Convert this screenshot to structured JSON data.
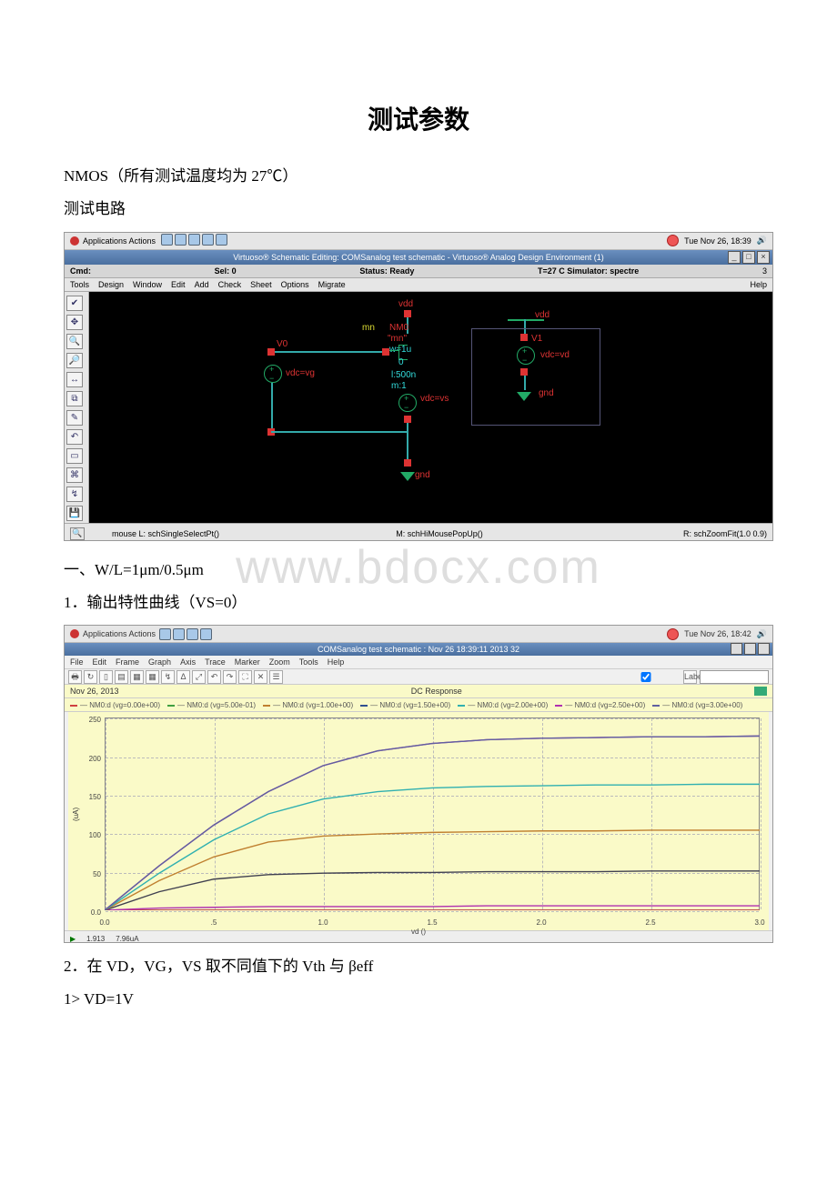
{
  "doc": {
    "title": "测试参数",
    "line1": "NMOS（所有测试温度均为 27℃）",
    "line2": "测试电路",
    "section1": "一、W/L=1μm/0.5μm",
    "item1": "1．输出特性曲线（VS=0）",
    "item2": "2．在 VD，VG，VS 取不同值下的 Vth 与 βeff",
    "sub1": "1> VD=1V",
    "watermark": "www.bdocx.com"
  },
  "shot1": {
    "apps": "Applications  Actions",
    "clock": "Tue Nov 26, 18:39",
    "title": "Virtuoso® Schematic Editing: COMSanalog test schematic  -  Virtuoso® Analog Design Environment (1)",
    "status": {
      "cmd": "Cmd:",
      "sel": "Sel: 0",
      "stat": "Status: Ready",
      "sim": "T=27 C  Simulator: spectre",
      "n": "3"
    },
    "menu": [
      "Tools",
      "Design",
      "Window",
      "Edit",
      "Add",
      "Check",
      "Sheet",
      "Options",
      "Migrate"
    ],
    "help": "Help",
    "labels": {
      "vdd1": "vdd",
      "vdd2": "vdd",
      "mn": "mn",
      "nm0": "NM0",
      "mnq": "\"mn\"",
      "w": "w=1u",
      "zero": "0",
      "l": "l:500n",
      "m": "m:1",
      "v0": "V0",
      "vdcvg": "vdc=vg",
      "vdcvs": "vdc=vs",
      "v1": "V1",
      "vdcvd": "vdc=vd",
      "gnd1": "gnd",
      "gnd2": "gnd"
    },
    "footer": {
      "l": "mouse L: schSingleSelectPt()",
      "m": "M: schHiMousePopUp()",
      "r": "R: schZoomFit(1.0 0.9)"
    }
  },
  "shot2": {
    "apps": "Applications  Actions",
    "clock": "Tue Nov 26, 18:42",
    "title": "COMSanalog test schematic : Nov 26 18:39:11 2013 32",
    "menu": [
      "File",
      "Edit",
      "Frame",
      "Graph",
      "Axis",
      "Trace",
      "Marker",
      "Zoom",
      "Tools",
      "Help"
    ],
    "label_chk": "Label:",
    "date": "Nov 26, 2013",
    "resp": "DC Response",
    "legend": [
      "NM0:d (vg=0.00e+00)",
      "NM0:d (vg=5.00e-01)",
      "NM0:d (vg=1.00e+00)",
      "NM0:d (vg=1.50e+00)",
      "NM0:d (vg=2.00e+00)",
      "NM0:d (vg=2.50e+00)",
      "NM0:d (vg=3.00e+00)"
    ],
    "legend_colors": [
      "#d04040",
      "#40a040",
      "#c08030",
      "#305090",
      "#30b0b0",
      "#b030b0",
      "#6060a0"
    ],
    "yticks": [
      "0.0",
      "50",
      "100",
      "150",
      "200",
      "250"
    ],
    "xticks": [
      "0.0",
      ".5",
      "1.0",
      "1.5",
      "2.0",
      "2.5",
      "3.0"
    ],
    "yunit": "(uA)",
    "xlabel": "vd ()",
    "cursor": {
      "x": "1.913",
      "y": "7.96uA"
    }
  },
  "chart_data": {
    "type": "line",
    "title": "DC Response",
    "xlabel": "vd ()",
    "ylabel": "(uA)",
    "xlim": [
      0,
      3.0
    ],
    "ylim": [
      0,
      260
    ],
    "x": [
      0.0,
      0.25,
      0.5,
      0.75,
      1.0,
      1.25,
      1.5,
      1.75,
      2.0,
      2.25,
      2.5,
      2.75,
      3.0
    ],
    "series": [
      {
        "name": "NM0:d (vg=0.00e+00)",
        "color": "#d04040",
        "values": [
          0,
          0,
          0,
          0,
          0,
          0,
          0,
          0,
          0,
          0,
          0,
          0,
          0
        ]
      },
      {
        "name": "NM0:d (vg=5.00e-01)",
        "color": "#b030b0",
        "values": [
          0,
          3,
          4,
          5,
          5,
          5,
          5,
          6,
          6,
          6,
          6,
          6,
          6
        ]
      },
      {
        "name": "NM0:d (vg=1.00e+00)",
        "color": "#404050",
        "values": [
          0,
          25,
          42,
          48,
          50,
          51,
          51,
          52,
          52,
          52,
          53,
          53,
          53
        ]
      },
      {
        "name": "NM0:d (vg=1.50e+00)",
        "color": "#c08030",
        "values": [
          0,
          40,
          72,
          92,
          100,
          103,
          105,
          106,
          107,
          107,
          108,
          108,
          108
        ]
      },
      {
        "name": "NM0:d (vg=2.00e+00)",
        "color": "#30b0b0",
        "values": [
          0,
          50,
          95,
          130,
          150,
          160,
          165,
          167,
          168,
          169,
          169,
          170,
          170
        ]
      },
      {
        "name": "NM0:d (vg=2.50e+00)",
        "color": "#b030b0",
        "values": [
          0,
          60,
          115,
          160,
          195,
          215,
          225,
          230,
          232,
          233,
          234,
          234,
          235
        ]
      },
      {
        "name": "NM0:d (vg=3.00e+00)",
        "color": "#6060a0",
        "values": [
          0,
          60,
          115,
          160,
          195,
          215,
          225,
          230,
          232,
          233,
          234,
          234,
          235
        ]
      }
    ]
  }
}
